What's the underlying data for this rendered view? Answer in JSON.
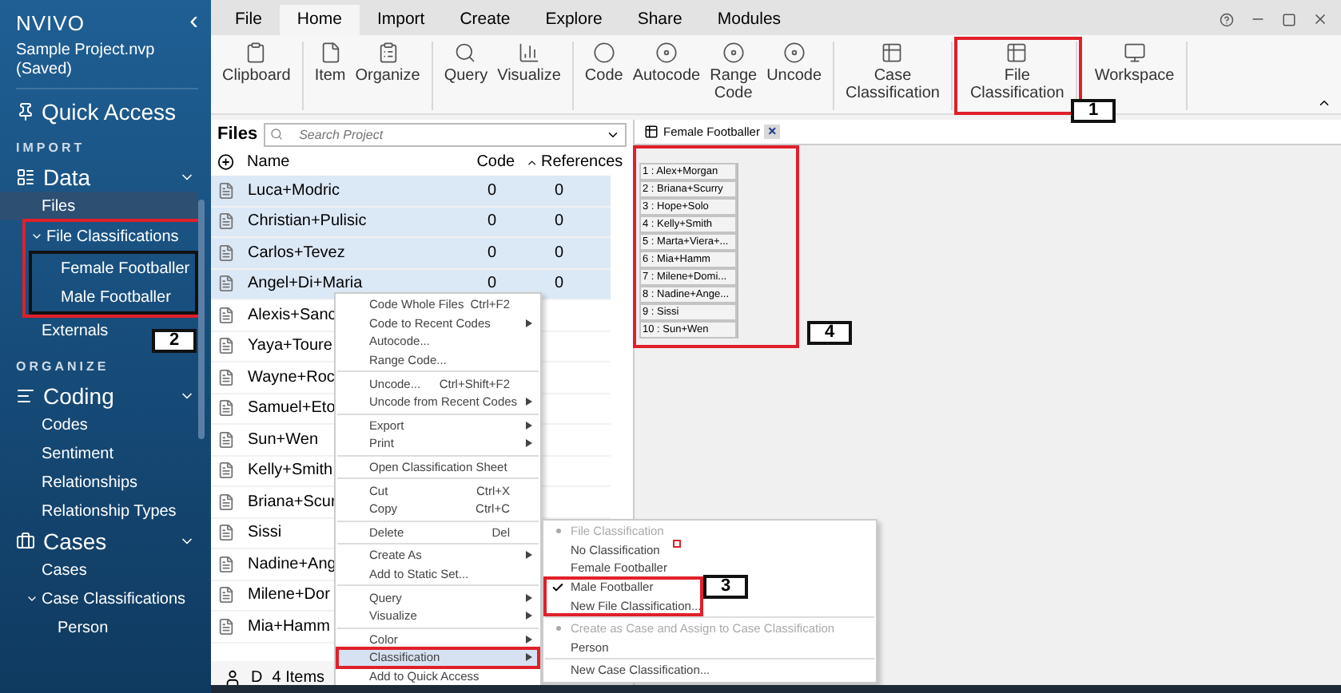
{
  "app": {
    "logo": "NVIVO",
    "project": "Sample Project.nvp (Saved)",
    "collapse_glyph": "‹"
  },
  "sidebar": {
    "quick_access": "Quick Access",
    "sections": [
      {
        "label": "IMPORT",
        "groups": [
          {
            "title": "Data",
            "expanded": true,
            "items": [
              {
                "label": "Files",
                "selected": true
              },
              {
                "label": "File Classifications",
                "selected": false,
                "expanded": true,
                "children": [
                  {
                    "label": "Female Footballer",
                    "selected": false
                  },
                  {
                    "label": "Male Footballer",
                    "selected": false
                  }
                ]
              },
              {
                "label": "Externals",
                "selected": false
              }
            ]
          }
        ]
      },
      {
        "label": "ORGANIZE",
        "groups": [
          {
            "title": "Coding",
            "expanded": true,
            "items": [
              {
                "label": "Codes",
                "selected": false
              },
              {
                "label": "Sentiment",
                "selected": false
              },
              {
                "label": "Relationships",
                "selected": false
              },
              {
                "label": "Relationship Types",
                "selected": false
              }
            ]
          },
          {
            "title": "Cases",
            "expanded": true,
            "items": [
              {
                "label": "Cases",
                "selected": false
              },
              {
                "label": "Case Classifications",
                "selected": false,
                "expanded": true,
                "children": [
                  {
                    "label": "Person",
                    "selected": false
                  }
                ]
              }
            ]
          }
        ]
      }
    ]
  },
  "ribbon": {
    "tabs": [
      {
        "label": "File",
        "selected": false
      },
      {
        "label": "Home",
        "selected": true
      },
      {
        "label": "Import",
        "selected": false
      },
      {
        "label": "Create",
        "selected": false
      },
      {
        "label": "Explore",
        "selected": false
      },
      {
        "label": "Share",
        "selected": false
      },
      {
        "label": "Modules",
        "selected": false
      }
    ],
    "groups": [
      [
        "Clipboard"
      ],
      [
        "Item",
        "Organize"
      ],
      [
        "Query",
        "Visualize"
      ],
      [
        "Code",
        "Autocode",
        "Range Code",
        "Uncode"
      ],
      [
        "Case Classification"
      ],
      [
        "File Classification"
      ],
      [
        "Workspace"
      ]
    ]
  },
  "files": {
    "title": "Files",
    "search": {
      "placeholder": "Search Project"
    },
    "columns": [
      "Name",
      "Code",
      "References"
    ],
    "rows": [
      {
        "name": "Luca+Modric",
        "code": "0",
        "references": "0",
        "selected": true
      },
      {
        "name": "Christian+Pulisic",
        "code": "0",
        "references": "0",
        "selected": true
      },
      {
        "name": "Carlos+Tevez",
        "code": "0",
        "references": "0",
        "selected": true
      },
      {
        "name": "Angel+Di+Maria",
        "code": "0",
        "references": "0",
        "selected": true
      },
      {
        "name": "Alexis+Sanc",
        "selected": false
      },
      {
        "name": "Yaya+Toure",
        "selected": false
      },
      {
        "name": "Wayne+Roc",
        "selected": false
      },
      {
        "name": "Samuel+Eto",
        "selected": false
      },
      {
        "name": "Sun+Wen",
        "selected": false
      },
      {
        "name": "Kelly+Smith",
        "selected": false
      },
      {
        "name": "Briana+Scur",
        "selected": false
      },
      {
        "name": "Sissi",
        "selected": false
      },
      {
        "name": "Nadine+Ang",
        "selected": false
      },
      {
        "name": "Milene+Dor",
        "selected": false
      },
      {
        "name": "Mia+Hamm",
        "selected": false
      }
    ],
    "status": {
      "user": "D",
      "count": "4 Items"
    }
  },
  "viewer": {
    "tab": "Female Footballer",
    "close": "×",
    "rows": [
      "1 : Alex+Morgan",
      "2 : Briana+Scurry",
      "3 : Hope+Solo",
      "4 : Kelly+Smith",
      "5 : Marta+Viera+...",
      "6 : Mia+Hamm",
      "7 : Milene+Domi...",
      "8 : Nadine+Ange...",
      "9 : Sissi",
      "10 : Sun+Wen"
    ]
  },
  "context_menu": [
    [
      {
        "label": "Code Whole Files",
        "shortcut": "Ctrl+F2",
        "submenu": false,
        "selected": false
      },
      {
        "label": "Code to Recent Codes",
        "submenu": true,
        "selected": false
      },
      {
        "label": "Autocode...",
        "submenu": false,
        "selected": false
      },
      {
        "label": "Range Code...",
        "submenu": false,
        "selected": false
      }
    ],
    [
      {
        "label": "Uncode...",
        "shortcut": "Ctrl+Shift+F2",
        "submenu": false,
        "selected": false
      },
      {
        "label": "Uncode from Recent Codes",
        "submenu": true,
        "selected": false
      }
    ],
    [
      {
        "label": "Export",
        "submenu": true,
        "selected": false
      },
      {
        "label": "Print",
        "submenu": true,
        "selected": false
      }
    ],
    [
      {
        "label": "Open Classification Sheet",
        "submenu": false,
        "selected": false
      }
    ],
    [
      {
        "label": "Cut",
        "shortcut": "Ctrl+X",
        "submenu": false,
        "selected": false
      },
      {
        "label": "Copy",
        "shortcut": "Ctrl+C",
        "submenu": false,
        "selected": false
      }
    ],
    [
      {
        "label": "Delete",
        "shortcut": "Del",
        "submenu": false,
        "selected": false
      }
    ],
    [
      {
        "label": "Create As",
        "submenu": true,
        "selected": false
      },
      {
        "label": "Add to Static Set...",
        "submenu": false,
        "selected": false
      }
    ],
    [
      {
        "label": "Query",
        "submenu": true,
        "selected": false
      },
      {
        "label": "Visualize",
        "submenu": true,
        "selected": false
      }
    ],
    [
      {
        "label": "Color",
        "submenu": true,
        "selected": false
      },
      {
        "label": "Classification",
        "submenu": true,
        "selected": true
      },
      {
        "label": "Add to Quick Access",
        "submenu": false,
        "selected": false
      }
    ]
  ],
  "submenu": [
    [
      {
        "label": "File Classification",
        "disabled": true,
        "checked": false
      },
      {
        "label": "No Classification",
        "disabled": false,
        "checked": false
      },
      {
        "label": "Female Footballer",
        "disabled": false,
        "checked": false
      },
      {
        "label": "Male Footballer",
        "disabled": false,
        "checked": true
      },
      {
        "label": "New File Classification...",
        "disabled": false,
        "checked": false
      }
    ],
    [
      {
        "label": "Create as Case and Assign to Case Classification",
        "disabled": true,
        "checked": false
      },
      {
        "label": "Person",
        "disabled": false,
        "checked": false
      }
    ],
    [
      {
        "label": "New Case Classification...",
        "disabled": false,
        "checked": false
      }
    ]
  ],
  "callouts": [
    "1",
    "2",
    "3",
    "4"
  ]
}
